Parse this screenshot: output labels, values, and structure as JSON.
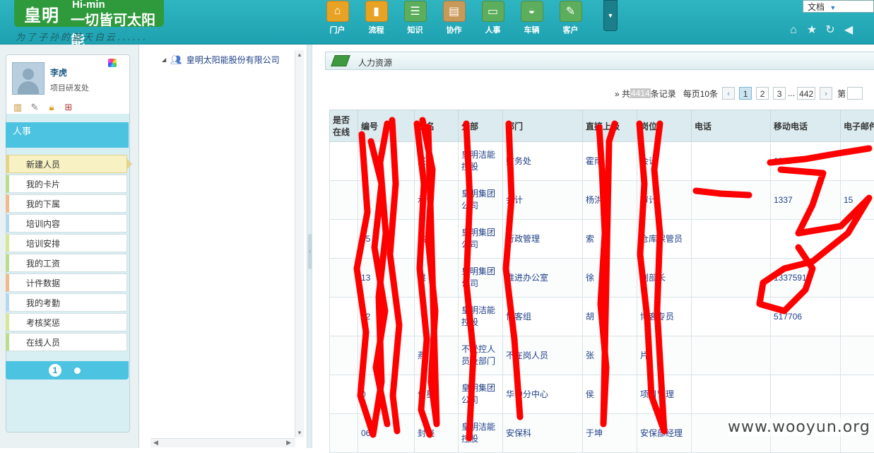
{
  "header": {
    "logo_mark": "皇明",
    "logo_en": "Hi-min",
    "logo_slogan": "一切皆可太阳能",
    "motto": "为了子孙的蓝天白云......",
    "nav": [
      {
        "label": "门户",
        "icon": "house-icon",
        "color": "#e8a325"
      },
      {
        "label": "流程",
        "icon": "bar-chart-icon",
        "color": "#e8a325"
      },
      {
        "label": "知识",
        "icon": "cabinet-icon",
        "color": "#5cae5c"
      },
      {
        "label": "协作",
        "icon": "clipboard-icon",
        "color": "#c89a5a"
      },
      {
        "label": "人事",
        "icon": "id-card-icon",
        "color": "#5cae5c"
      },
      {
        "label": "车辆",
        "icon": "car-icon",
        "color": "#5cae5c"
      },
      {
        "label": "客户",
        "icon": "handshake-icon",
        "color": "#5cae5c"
      }
    ],
    "doc_select": "文档",
    "tools": [
      "home-icon",
      "star-icon",
      "refresh-icon",
      "back-icon"
    ]
  },
  "user": {
    "name": "李虎",
    "dept": "项目研发处",
    "tools": [
      "book-icon",
      "notepad-icon",
      "lock-icon",
      "org-chart-icon"
    ]
  },
  "sidebar": {
    "module_title": "人事",
    "items": [
      {
        "label": "新建人员",
        "active": true,
        "color": "#e1d48c"
      },
      {
        "label": "我的卡片",
        "active": false,
        "color": "#bedc8e"
      },
      {
        "label": "我的下属",
        "active": false,
        "color": "#f2b98c"
      },
      {
        "label": "培训内容",
        "active": false,
        "color": "#b5d8ee"
      },
      {
        "label": "培训安排",
        "active": false,
        "color": "#d6e79a"
      },
      {
        "label": "我的工资",
        "active": false,
        "color": "#bedc8e"
      },
      {
        "label": "计件数据",
        "active": false,
        "color": "#f2b98c"
      },
      {
        "label": "我的考勤",
        "active": false,
        "color": "#b5d8ee"
      },
      {
        "label": "考核奖惩",
        "active": false,
        "color": "#d6e79a"
      },
      {
        "label": "在线人员",
        "active": false,
        "color": "#bedc8e"
      }
    ],
    "page_current": "1"
  },
  "tree": {
    "root_label": "皇明太阳能股份有限公司"
  },
  "main": {
    "title": "人力资源",
    "pager": {
      "prefix": "» 共",
      "total": "4414",
      "suffix": "条记录",
      "per_page": "每页10条",
      "pages": [
        "1",
        "2",
        "3"
      ],
      "ellipsis": "...",
      "last": "442",
      "goto": "第"
    },
    "columns": [
      "是否在线",
      "编号",
      "姓名",
      "分部",
      "部门",
      "直接上级",
      "岗位",
      "电话",
      "移动电话",
      "电子邮件"
    ],
    "rows": [
      [
        "",
        "",
        "兴",
        "皇明洁能控股",
        "财务处",
        "霍雨",
        "会计",
        "",
        "1339",
        ""
      ],
      [
        "",
        "",
        "承青",
        "皇明集团公司",
        "会计",
        "杨洪",
        "审计",
        "",
        "1337",
        "15"
      ],
      [
        "",
        "05",
        "洪英",
        "皇明集团公司",
        "行政管理",
        "索",
        "仓库保管员",
        "",
        "",
        ""
      ],
      [
        "",
        "13",
        "洪",
        "皇明集团公司",
        "推进办公室",
        "徐",
        "副部长",
        "",
        "13375911",
        ""
      ],
      [
        "",
        "22",
        "",
        "皇明洁能控股",
        "博客组",
        "胡",
        "博客专员",
        "",
        "517706",
        ""
      ],
      [
        "",
        "0",
        "燕",
        "不受控人员及部门",
        "不在岗人员",
        "张",
        "片",
        "",
        "",
        ""
      ],
      [
        "",
        "0",
        "何星",
        "皇明集团公司",
        "华中分中心",
        "侯",
        "项目管理",
        "",
        "",
        ""
      ],
      [
        "",
        "06",
        "封晓",
        "皇明洁能控股",
        "安保科",
        "于坤",
        "安保部经理",
        "",
        "",
        ""
      ]
    ]
  },
  "watermark": "www.wooyun.org",
  "colors": {
    "header": "#1ea1b0",
    "accent": "#4cc3e0",
    "scribble": "#ff0000"
  }
}
